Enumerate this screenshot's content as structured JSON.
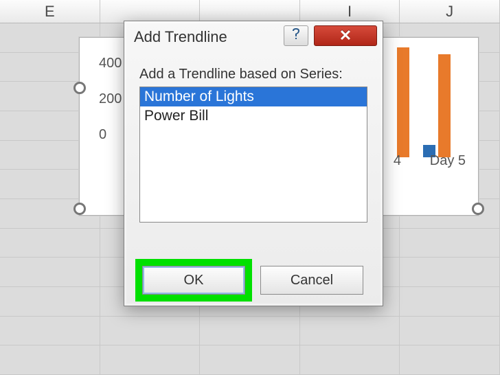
{
  "columns": [
    "E",
    "",
    "",
    "I",
    "J"
  ],
  "chart": {
    "y_ticks": [
      "400",
      "200",
      "0"
    ],
    "category_label": "Day 5",
    "partial_category_label": "4"
  },
  "dialog": {
    "title": "Add Trendline",
    "instruction": "Add a Trendline based on Series:",
    "items": [
      "Number of Lights",
      "Power Bill"
    ],
    "selected_index": 0,
    "ok_label": "OK",
    "cancel_label": "Cancel"
  },
  "chart_data": {
    "type": "bar",
    "categories": [
      "Day 5"
    ],
    "series": [
      {
        "name": "Number of Lights",
        "values": [
          30
        ]
      },
      {
        "name": "Power Bill",
        "values": [
          350
        ]
      }
    ],
    "ylim": [
      0,
      400
    ],
    "title": "",
    "xlabel": "",
    "ylabel": ""
  }
}
